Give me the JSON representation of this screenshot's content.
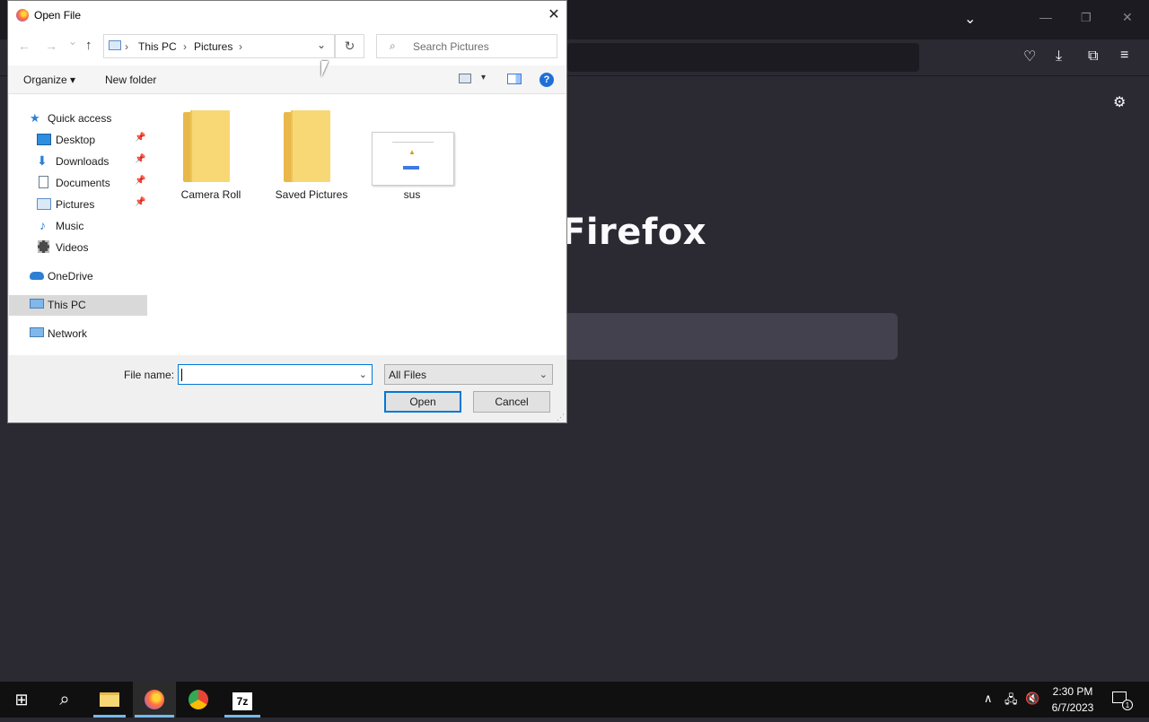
{
  "browser": {
    "brand": "Firefox",
    "icons": {
      "menu": "chevron-down-icon",
      "pocket": "pocket-icon",
      "downloads": "download-icon",
      "extensions": "extensions-icon",
      "hamburger": "hamburger-menu-icon",
      "settings": "gear-icon",
      "minimize": "minimize-icon",
      "restore": "restore-icon",
      "close": "close-icon"
    }
  },
  "dialog": {
    "title": "Open File",
    "close_glyph": "✕",
    "nav": {
      "back": "←",
      "forward": "→",
      "recent": "⌄",
      "up": "↑",
      "refresh": "↻"
    },
    "breadcrumb": [
      "This PC",
      "Pictures"
    ],
    "breadcrumb_sep": "›",
    "search_placeholder": "Search Pictures",
    "toolbar": {
      "organize": "Organize ▾",
      "new_folder": "New folder",
      "help": "?"
    },
    "nav_pane": {
      "quick_access": "Quick access",
      "items": [
        "Desktop",
        "Downloads",
        "Documents",
        "Pictures",
        "Music",
        "Videos"
      ],
      "onedrive": "OneDrive",
      "this_pc": "This PC",
      "network": "Network"
    },
    "files": [
      "Camera Roll",
      "Saved Pictures",
      "sus"
    ],
    "file_name_label": "File name:",
    "file_name_value": "",
    "file_type": "All Files",
    "open_label": "Open",
    "cancel_label": "Cancel"
  },
  "taskbar": {
    "time": "2:30 PM",
    "date": "6/7/2023",
    "notifications": "1"
  }
}
